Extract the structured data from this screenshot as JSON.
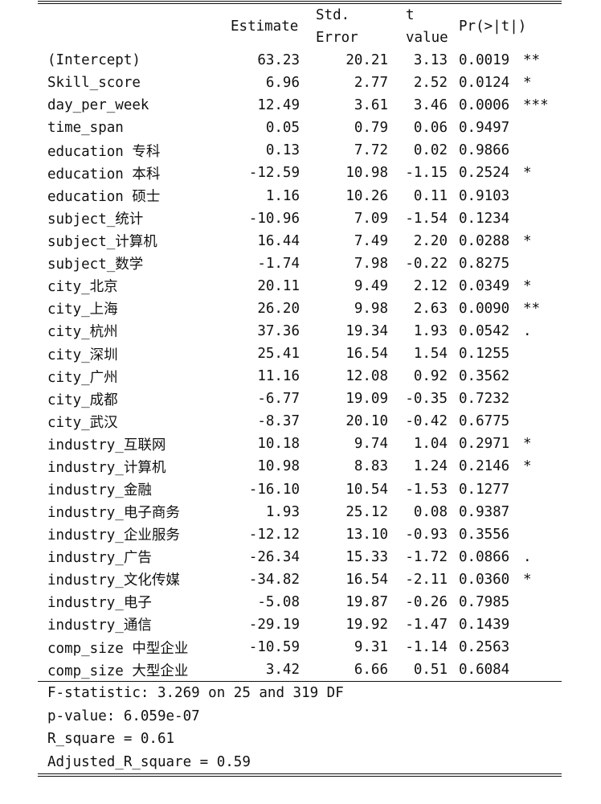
{
  "headers": {
    "estimate": "Estimate",
    "std_error_1": "Std.",
    "std_error_2": "Error",
    "t_value_1": "t",
    "t_value_2": "value",
    "p_value": "Pr(>|t|)"
  },
  "rows": [
    {
      "name": "(Intercept)",
      "estimate": "63.23",
      "se": "20.21",
      "t": "3.13",
      "p": "0.0019",
      "sig": "**"
    },
    {
      "name": "Skill_score",
      "estimate": "6.96",
      "se": "2.77",
      "t": "2.52",
      "p": "0.0124",
      "sig": "*"
    },
    {
      "name": "day_per_week",
      "estimate": "12.49",
      "se": "3.61",
      "t": "3.46",
      "p": "0.0006",
      "sig": "***"
    },
    {
      "name": "time_span",
      "estimate": "0.05",
      "se": "0.79",
      "t": "0.06",
      "p": "0.9497",
      "sig": ""
    },
    {
      "name": "education 专科",
      "estimate": "0.13",
      "se": "7.72",
      "t": "0.02",
      "p": "0.9866",
      "sig": ""
    },
    {
      "name": "education 本科",
      "estimate": "-12.59",
      "se": "10.98",
      "t": "-1.15",
      "p": "0.2524",
      "sig": "*"
    },
    {
      "name": "education 硕士",
      "estimate": "1.16",
      "se": "10.26",
      "t": "0.11",
      "p": "0.9103",
      "sig": ""
    },
    {
      "name": "subject_统计",
      "estimate": "-10.96",
      "se": "7.09",
      "t": "-1.54",
      "p": "0.1234",
      "sig": ""
    },
    {
      "name": "subject_计算机",
      "estimate": "16.44",
      "se": "7.49",
      "t": "2.20",
      "p": "0.0288",
      "sig": "*"
    },
    {
      "name": "subject_数学",
      "estimate": "-1.74",
      "se": "7.98",
      "t": "-0.22",
      "p": "0.8275",
      "sig": ""
    },
    {
      "name": "city_北京",
      "estimate": "20.11",
      "se": "9.49",
      "t": "2.12",
      "p": "0.0349",
      "sig": "*"
    },
    {
      "name": "city_上海",
      "estimate": "26.20",
      "se": "9.98",
      "t": "2.63",
      "p": "0.0090",
      "sig": "**"
    },
    {
      "name": "city_杭州",
      "estimate": "37.36",
      "se": "19.34",
      "t": "1.93",
      "p": "0.0542",
      "sig": "."
    },
    {
      "name": "city_深圳",
      "estimate": "25.41",
      "se": "16.54",
      "t": "1.54",
      "p": "0.1255",
      "sig": ""
    },
    {
      "name": "city_广州",
      "estimate": "11.16",
      "se": "12.08",
      "t": "0.92",
      "p": "0.3562",
      "sig": ""
    },
    {
      "name": "city_成都",
      "estimate": "-6.77",
      "se": "19.09",
      "t": "-0.35",
      "p": "0.7232",
      "sig": ""
    },
    {
      "name": "city_武汉",
      "estimate": "-8.37",
      "se": "20.10",
      "t": "-0.42",
      "p": "0.6775",
      "sig": ""
    },
    {
      "name": "industry_互联网",
      "estimate": "10.18",
      "se": "9.74",
      "t": "1.04",
      "p": "0.2971",
      "sig": "*"
    },
    {
      "name": "industry_计算机",
      "estimate": "10.98",
      "se": "8.83",
      "t": "1.24",
      "p": "0.2146",
      "sig": "*"
    },
    {
      "name": "industry_金融",
      "estimate": "-16.10",
      "se": "10.54",
      "t": "-1.53",
      "p": "0.1277",
      "sig": ""
    },
    {
      "name": "industry_电子商务",
      "estimate": "1.93",
      "se": "25.12",
      "t": "0.08",
      "p": "0.9387",
      "sig": ""
    },
    {
      "name": "industry_企业服务",
      "estimate": "-12.12",
      "se": "13.10",
      "t": "-0.93",
      "p": "0.3556",
      "sig": ""
    },
    {
      "name": "industry_广告",
      "estimate": "-26.34",
      "se": "15.33",
      "t": "-1.72",
      "p": "0.0866",
      "sig": "."
    },
    {
      "name": "industry_文化传媒",
      "estimate": "-34.82",
      "se": "16.54",
      "t": "-2.11",
      "p": "0.0360",
      "sig": "*"
    },
    {
      "name": "industry_电子",
      "estimate": "-5.08",
      "se": "19.87",
      "t": "-0.26",
      "p": "0.7985",
      "sig": ""
    },
    {
      "name": "industry_通信",
      "estimate": "-29.19",
      "se": "19.92",
      "t": "-1.47",
      "p": "0.1439",
      "sig": ""
    },
    {
      "name": "comp_size 中型企业",
      "estimate": "-10.59",
      "se": "9.31",
      "t": "-1.14",
      "p": "0.2563",
      "sig": ""
    },
    {
      "name": "comp_size 大型企业",
      "estimate": "3.42",
      "se": "6.66",
      "t": "0.51",
      "p": "0.6084",
      "sig": ""
    }
  ],
  "summary": {
    "f_stat": "F-statistic: 3.269 on 25 and 319 DF",
    "p_value": "p-value: 6.059e-07",
    "r_square": "R_square = 0.61",
    "adj_r_square": "Adjusted_R_square = 0.59"
  }
}
